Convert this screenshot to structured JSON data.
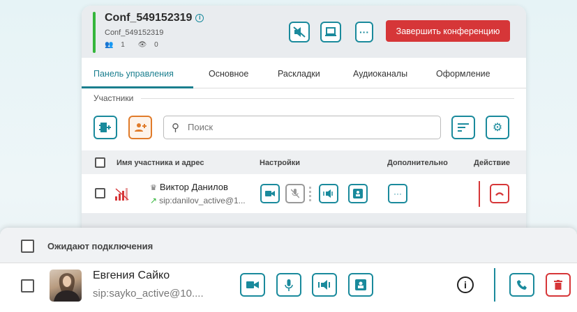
{
  "conference": {
    "title": "Conf_549152319",
    "subtitle": "Conf_549152319",
    "participants_count": "1",
    "viewers_count": "0",
    "end_button": "Завершить конференцию",
    "header_icons": [
      "speaker-mute-icon",
      "screen-share-icon",
      "more-icon"
    ]
  },
  "tabs": [
    {
      "label": "Панель управления",
      "active": true
    },
    {
      "label": "Основное",
      "active": false
    },
    {
      "label": "Раскладки",
      "active": false
    },
    {
      "label": "Аудиоканалы",
      "active": false
    },
    {
      "label": "Оформление",
      "active": false
    }
  ],
  "participants_section": {
    "label": "Участники",
    "search_placeholder": "Поиск"
  },
  "table": {
    "headers": {
      "name": "Имя участника и адрес",
      "settings": "Настройки",
      "extra": "Дополнительно",
      "action": "Действие"
    },
    "rows": [
      {
        "name": "Виктор Данилов",
        "address": "sip:danilov_active@1...",
        "moderator": true,
        "signal": "poor"
      }
    ]
  },
  "waiting": {
    "title": "Ожидают подключения",
    "items": [
      {
        "name": "Евгения Сайко",
        "address": "sip:sayko_active@10...."
      }
    ]
  },
  "colors": {
    "accent": "#1a8a9c",
    "danger": "#d63638",
    "online": "#35b63c",
    "add_user": "#e07b2a"
  }
}
